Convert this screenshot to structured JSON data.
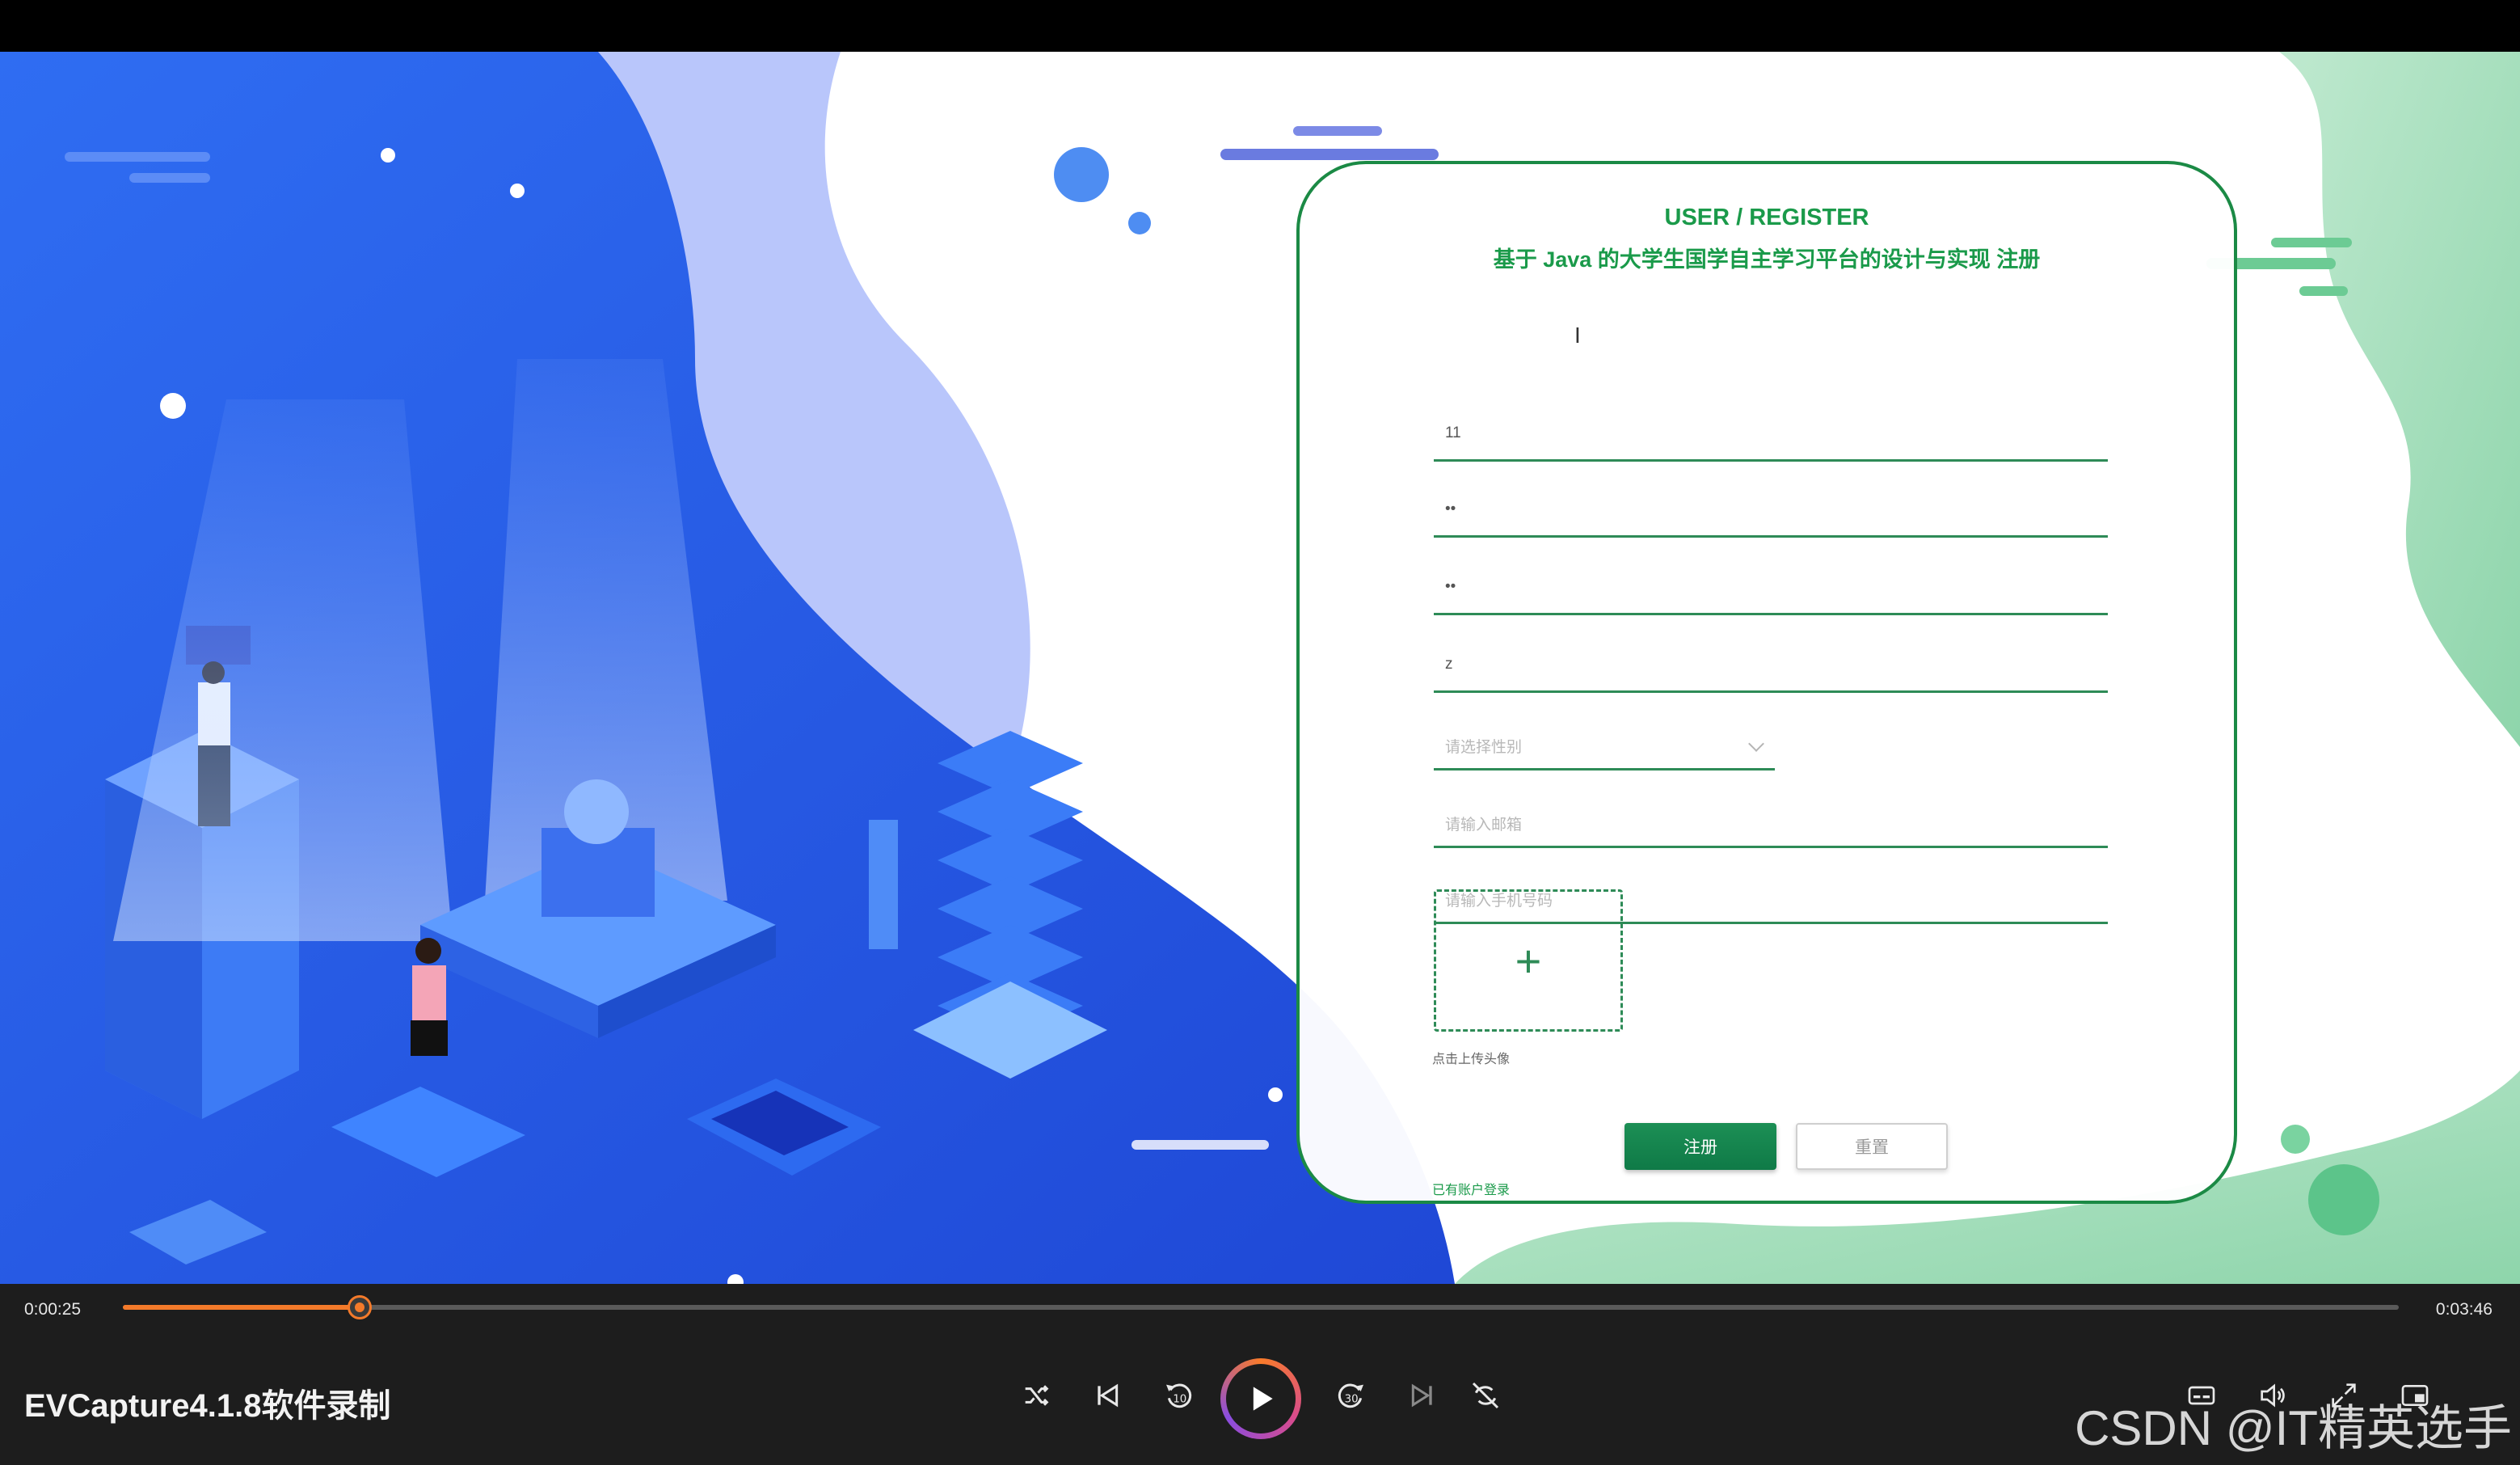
{
  "form": {
    "title": "USER / REGISTER",
    "subtitle": "基于 Java 的大学生国学自主学习平台的设计与实现 注册",
    "fields": [
      {
        "value": "11"
      },
      {
        "value": "••"
      },
      {
        "value": "••"
      },
      {
        "value": "z"
      }
    ],
    "gender": {
      "placeholder": "请选择性别"
    },
    "email": {
      "placeholder": "请输入邮箱"
    },
    "phone": {
      "placeholder": "请输入手机号码"
    },
    "upload_plus": "+",
    "upload_hint": "点击上传头像",
    "register_label": "注册",
    "reset_label": "重置",
    "login_link": "已有账户登录"
  },
  "player": {
    "current_time": "0:00:25",
    "total_time": "0:03:46",
    "progress": 0.104,
    "app_name": "EVCapture4.1.8软件录制",
    "controls": [
      "shuffle-icon",
      "skip-previous-icon",
      "rewind-10-icon",
      "play-icon",
      "forward-30-icon",
      "skip-next-icon",
      "repeat-off-icon",
      "subtitles-icon",
      "volume-icon",
      "expand-icon",
      "pip-icon"
    ]
  },
  "watermark": "CSDN @IT精英选手",
  "colors": {
    "accent_green": "#1a9a4a",
    "progress_orange": "#f47a2a",
    "bg_blue": "#2a5ff0"
  }
}
